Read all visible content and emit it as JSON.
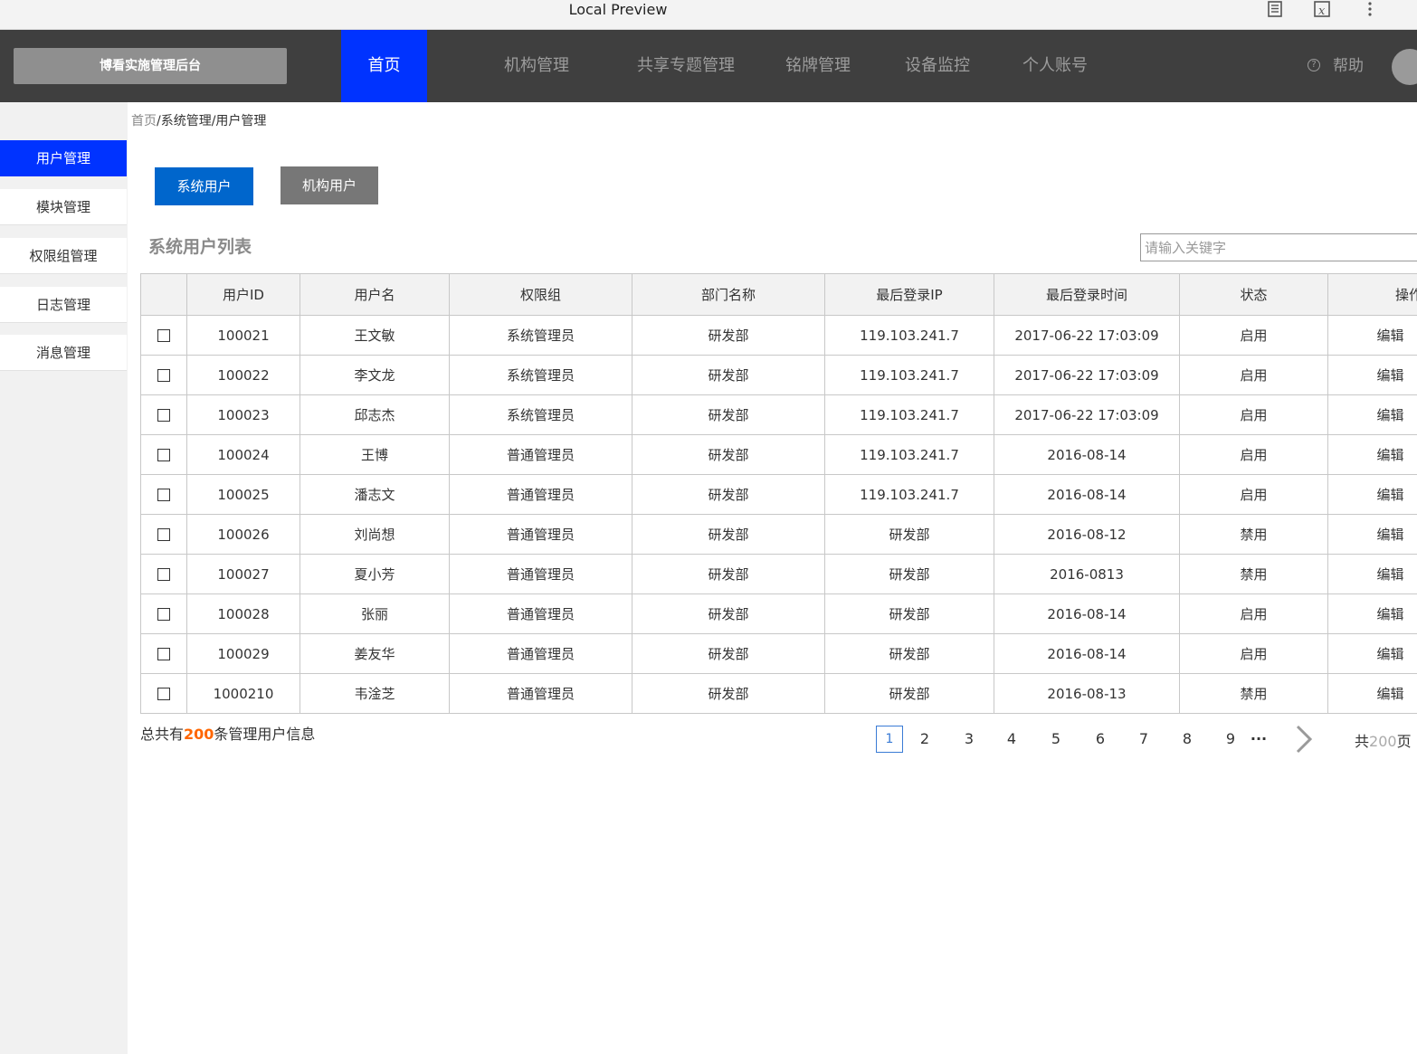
{
  "browser": {
    "title": "Local Preview",
    "icons": [
      "reader-icon",
      "extension-icon",
      "more-icon"
    ]
  },
  "brand": "博看实施管理后台",
  "nav": [
    {
      "label": "首页",
      "active": true
    },
    {
      "label": "机构管理"
    },
    {
      "label": "共享专题管理"
    },
    {
      "label": "铭牌管理"
    },
    {
      "label": "设备监控"
    },
    {
      "label": "个人账号"
    }
  ],
  "help": {
    "icon": "?",
    "label": "帮助"
  },
  "sidebar": [
    {
      "label": "用户管理",
      "active": true
    },
    {
      "label": "模块管理"
    },
    {
      "label": "权限组管理"
    },
    {
      "label": "日志管理"
    },
    {
      "label": "消息管理"
    }
  ],
  "breadcrumb": {
    "home": "首页",
    "rest": "/系统管理/用户管理"
  },
  "tabs": {
    "system": "系统用户",
    "org": "机构用户"
  },
  "list_title": "系统用户列表",
  "search": {
    "placeholder": "请输入关键字",
    "value": ""
  },
  "table": {
    "headers": [
      "",
      "用户ID",
      "用户名",
      "权限组",
      "部门名称",
      "最后登录IP",
      "最后登录时间",
      "状态",
      "操作"
    ],
    "rows": [
      [
        "100021",
        "王文敏",
        "系统管理员",
        "研发部",
        "119.103.241.7",
        "2017-06-22 17:03:09",
        "启用",
        "编辑"
      ],
      [
        "100022",
        "李文龙",
        "系统管理员",
        "研发部",
        "119.103.241.7",
        "2017-06-22 17:03:09",
        "启用",
        "编辑"
      ],
      [
        "100023",
        "邱志杰",
        "系统管理员",
        "研发部",
        "119.103.241.7",
        "2017-06-22 17:03:09",
        "启用",
        "编辑"
      ],
      [
        "100024",
        "王博",
        "普通管理员",
        "研发部",
        "119.103.241.7",
        "2016-08-14",
        "启用",
        "编辑"
      ],
      [
        "100025",
        "潘志文",
        "普通管理员",
        "研发部",
        "119.103.241.7",
        "2016-08-14",
        "启用",
        "编辑"
      ],
      [
        "100026",
        "刘尚想",
        "普通管理员",
        "研发部",
        "研发部",
        "2016-08-12",
        "禁用",
        "编辑"
      ],
      [
        "100027",
        "夏小芳",
        "普通管理员",
        "研发部",
        "研发部",
        "2016-0813",
        "禁用",
        "编辑"
      ],
      [
        "100028",
        "张丽",
        "普通管理员",
        "研发部",
        "研发部",
        "2016-08-14",
        "启用",
        "编辑"
      ],
      [
        "100029",
        "姜友华",
        "普通管理员",
        "研发部",
        "研发部",
        "2016-08-14",
        "启用",
        "编辑"
      ],
      [
        "1000210",
        "韦淦芝",
        "普通管理员",
        "研发部",
        "研发部",
        "2016-08-13",
        "禁用",
        "编辑"
      ]
    ]
  },
  "footer": {
    "total_prefix": "总共有",
    "total_count": "200",
    "total_suffix": "条管理用户信息",
    "pages": [
      "1",
      "2",
      "3",
      "4",
      "5",
      "6",
      "7",
      "8",
      "9"
    ],
    "current_page": "1",
    "ellipsis": "···",
    "pages_prefix": "共",
    "pages_total": "200",
    "pages_suffix": "页"
  },
  "colors": {
    "nav_bg": "#3f3f3f",
    "accent": "#0033ff",
    "primary_button": "#0066cc",
    "secondary_button": "#777777",
    "highlight": "#ff6600"
  }
}
